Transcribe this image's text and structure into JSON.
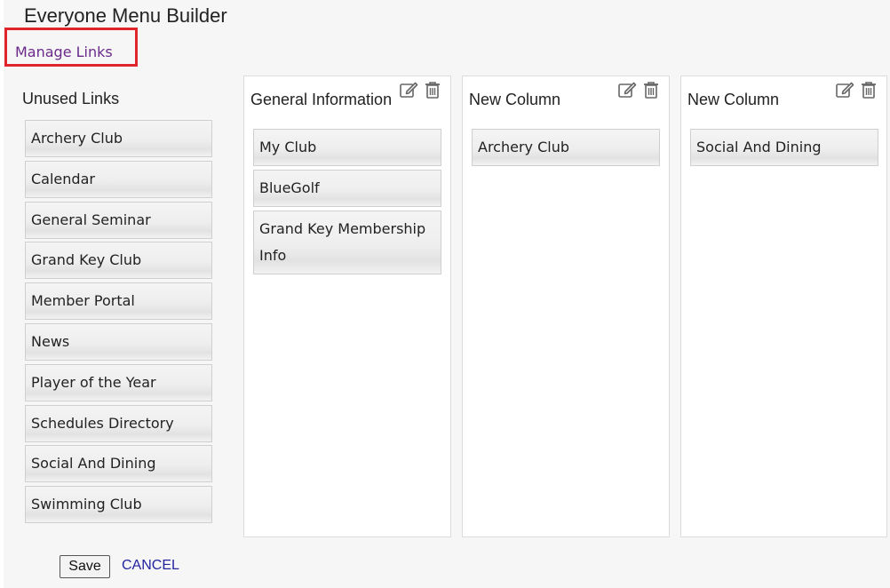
{
  "page": {
    "title": "Everyone Menu Builder",
    "manage_links_label": "Manage Links"
  },
  "unused": {
    "title": "Unused Links",
    "items": [
      {
        "label": "Archery Club"
      },
      {
        "label": "Calendar"
      },
      {
        "label": "General Seminar"
      },
      {
        "label": "Grand Key Club"
      },
      {
        "label": "Member Portal"
      },
      {
        "label": "News"
      },
      {
        "label": "Player of the Year"
      },
      {
        "label": "Schedules Directory"
      },
      {
        "label": "Social And Dining"
      },
      {
        "label": "Swimming Club"
      }
    ]
  },
  "columns": [
    {
      "title": "General Information",
      "items": [
        {
          "label": "My Club"
        },
        {
          "label": "BlueGolf"
        },
        {
          "label": "Grand Key Membership Info"
        }
      ]
    },
    {
      "title": "New Column",
      "items": [
        {
          "label": "Archery Club"
        }
      ]
    },
    {
      "title": "New Column",
      "items": [
        {
          "label": "Social And Dining"
        }
      ]
    }
  ],
  "actions": {
    "save_label": "Save",
    "cancel_label": "CANCEL"
  },
  "icons": {
    "edit": "edit-icon",
    "delete": "trash-icon"
  },
  "colors": {
    "highlight_border": "#e0242c",
    "manage_link": "#6a2a8a",
    "cancel_link": "#2323a0",
    "icon": "#666666"
  }
}
